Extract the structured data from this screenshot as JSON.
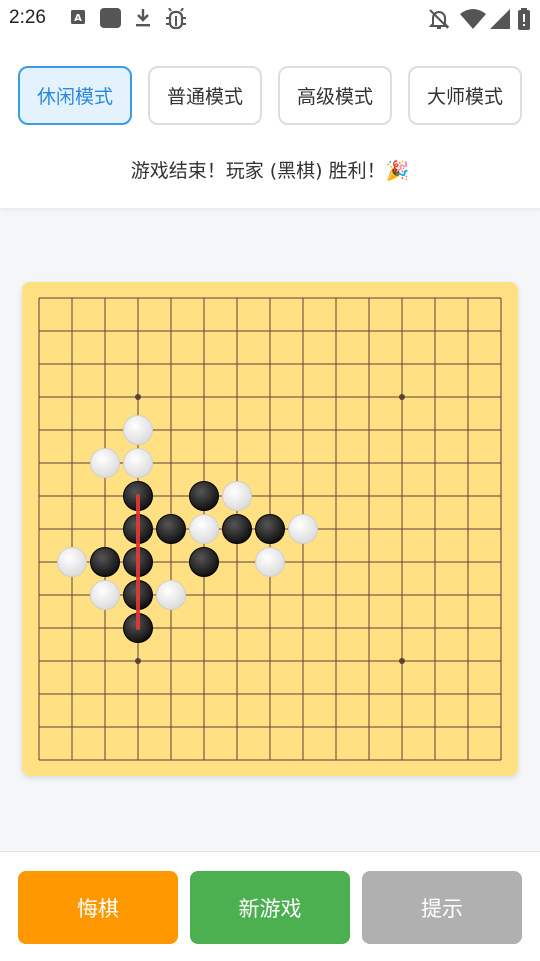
{
  "status_bar": {
    "time": "2:26",
    "left_icons": [
      "a-box-icon",
      "app-square-icon",
      "download-icon",
      "bug-icon"
    ],
    "right_icons": [
      "bell-off-icon",
      "wifi-icon",
      "signal-icon",
      "battery-icon"
    ]
  },
  "modes": [
    {
      "label": "休闲模式",
      "active": true
    },
    {
      "label": "普通模式",
      "active": false
    },
    {
      "label": "高级模式",
      "active": false
    },
    {
      "label": "大师模式",
      "active": false
    }
  ],
  "game_status": "游戏结束！玩家 (黑棋) 胜利！🎉",
  "board": {
    "size": 15,
    "colors": {
      "background": "#ffe082",
      "line": "#5d4037",
      "win_line": "#e53935"
    },
    "star_points": [
      [
        3,
        3
      ],
      [
        3,
        11
      ],
      [
        11,
        3
      ],
      [
        11,
        11
      ]
    ],
    "black_stones": [
      [
        6,
        3
      ],
      [
        6,
        5
      ],
      [
        7,
        3
      ],
      [
        7,
        4
      ],
      [
        7,
        6
      ],
      [
        7,
        7
      ],
      [
        8,
        2
      ],
      [
        8,
        3
      ],
      [
        8,
        5
      ],
      [
        9,
        3
      ],
      [
        10,
        3
      ]
    ],
    "white_stones": [
      [
        4,
        3
      ],
      [
        5,
        2
      ],
      [
        5,
        3
      ],
      [
        6,
        6
      ],
      [
        7,
        5
      ],
      [
        7,
        8
      ],
      [
        8,
        1
      ],
      [
        8,
        7
      ],
      [
        9,
        2
      ],
      [
        9,
        4
      ]
    ],
    "winning_line": {
      "from": [
        6,
        3
      ],
      "to": [
        10,
        3
      ]
    }
  },
  "actions": [
    {
      "label": "悔棋",
      "color": "#ff9800"
    },
    {
      "label": "新游戏",
      "color": "#4caf50"
    },
    {
      "label": "提示",
      "color": "#b0b0b0"
    }
  ]
}
